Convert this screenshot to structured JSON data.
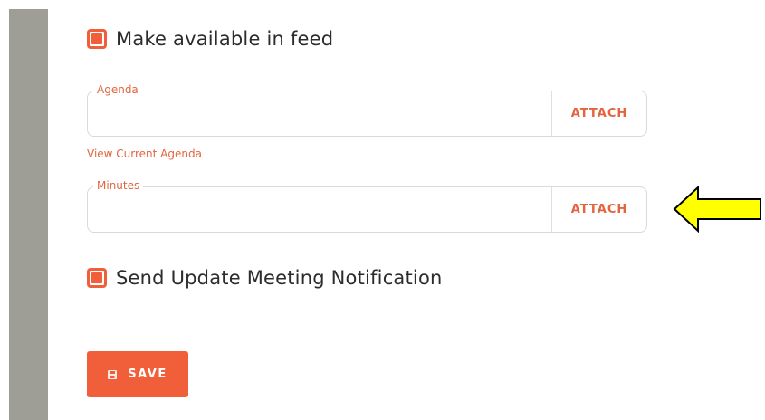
{
  "feed_checkbox": {
    "label": "Make available in feed",
    "checked": true
  },
  "agenda": {
    "label": "Agenda",
    "value": "",
    "attach_label": "ATTACH",
    "view_link": "View Current Agenda"
  },
  "minutes": {
    "label": "Minutes",
    "value": "",
    "attach_label": "ATTACH"
  },
  "notify_checkbox": {
    "label": "Send Update Meeting Notification",
    "checked": true
  },
  "save_button": {
    "label": "SAVE",
    "icon": "floppy-disk-icon"
  },
  "annotation": {
    "icon": "left-arrow-icon",
    "color": "#ffff00"
  },
  "colors": {
    "accent": "#f15e3a",
    "accent_text": "#e3653f",
    "sidebar": "#9e9e97"
  }
}
